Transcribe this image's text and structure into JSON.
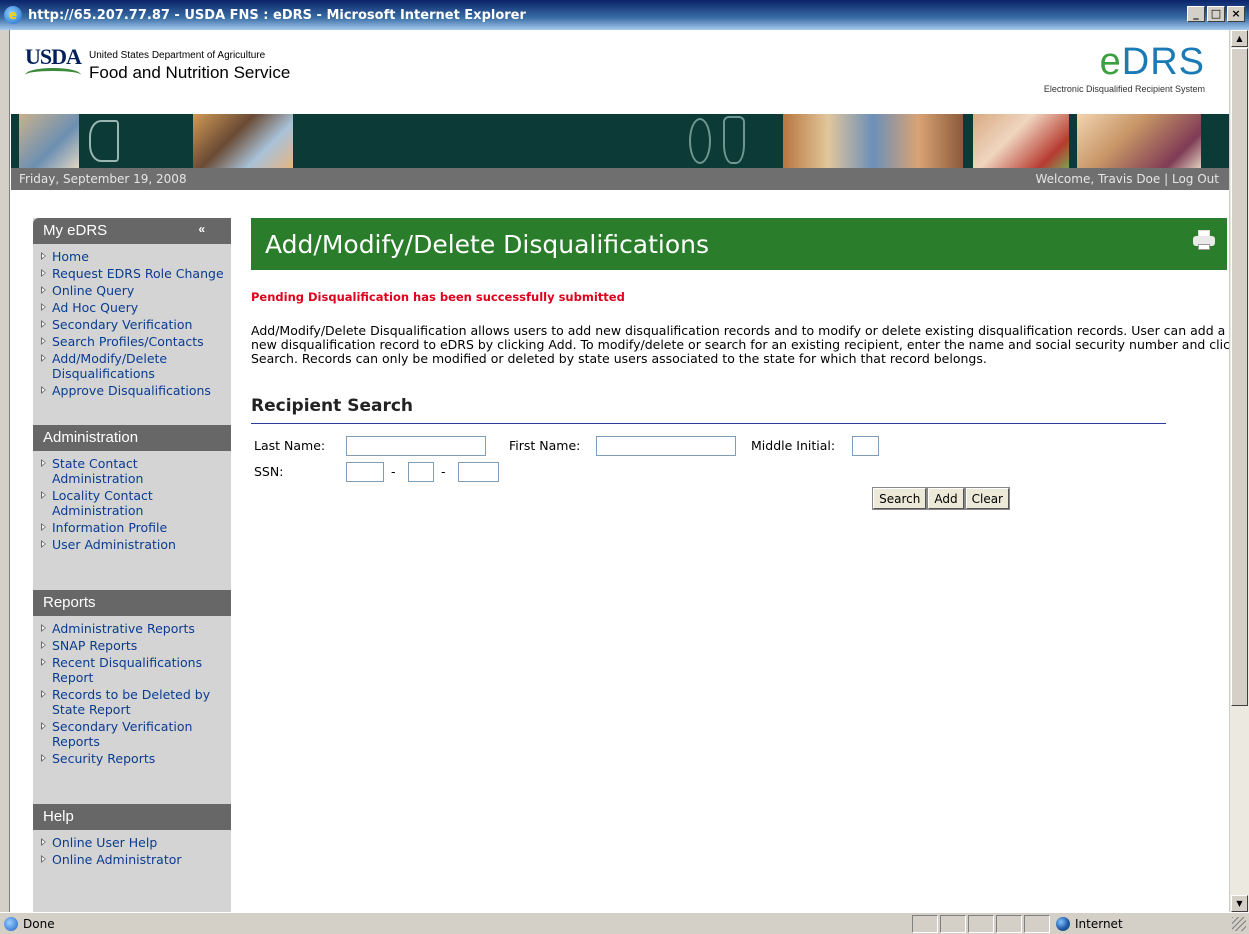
{
  "window": {
    "title": "http://65.207.77.87 - USDA FNS : eDRS - Microsoft Internet Explorer",
    "minimize": "_",
    "maximize": "□",
    "close": "×"
  },
  "header": {
    "logo_text": "USDA",
    "agency_line1": "United States Department of Agriculture",
    "agency_line2": "Food and Nutrition Service",
    "edrs_logo_e": "e",
    "edrs_logo_rest": "DRS",
    "edrs_subtitle": "Electronic Disqualified Recipient System"
  },
  "topbar": {
    "date": "Friday, September 19, 2008",
    "welcome": "Welcome, Travis Doe",
    "separator": "|",
    "logout": "Log Out"
  },
  "sidebar": {
    "my_edrs": {
      "title": "My eDRS",
      "collapse": "«",
      "items": [
        "Home",
        "Request EDRS Role Change",
        "Online Query",
        "Ad Hoc Query",
        "Secondary Verification",
        "Search Profiles/Contacts",
        "Add/Modify/Delete Disqualifications",
        "Approve Disqualifications"
      ]
    },
    "administration": {
      "title": "Administration",
      "items": [
        "State Contact Administration",
        "Locality Contact Administration",
        "Information Profile",
        "User Administration"
      ]
    },
    "reports": {
      "title": "Reports",
      "items": [
        "Administrative Reports",
        "SNAP Reports",
        "Recent Disqualifications Report",
        "Records to be Deleted by State Report",
        "Secondary Verification Reports",
        "Security Reports"
      ]
    },
    "help": {
      "title": "Help",
      "items": [
        "Online User Help",
        "Online Administrator"
      ]
    }
  },
  "main": {
    "page_title": "Add/Modify/Delete Disqualifications",
    "success_message": "Pending Disqualification has been successfully submitted",
    "description": "Add/Modify/Delete Disqualification allows users to add new disqualification records and to modify or delete existing disqualification records. User can add a new disqualification record to eDRS by clicking Add. To modify/delete or search for an existing recipient, enter the name and social security number and click Search. Records can only be modified or deleted by state users associated to the state for which that record belongs.",
    "search": {
      "title": "Recipient Search",
      "last_name_label": "Last Name:",
      "first_name_label": "First Name:",
      "middle_initial_label": "Middle Initial:",
      "ssn_label": "SSN:",
      "ssn_sep": "-",
      "last_name_value": "",
      "first_name_value": "",
      "middle_initial_value": "",
      "ssn1_value": "",
      "ssn2_value": "",
      "ssn3_value": "",
      "search_btn": "Search",
      "add_btn": "Add",
      "clear_btn": "Clear"
    }
  },
  "statusbar": {
    "status": "Done",
    "zone": "Internet"
  }
}
